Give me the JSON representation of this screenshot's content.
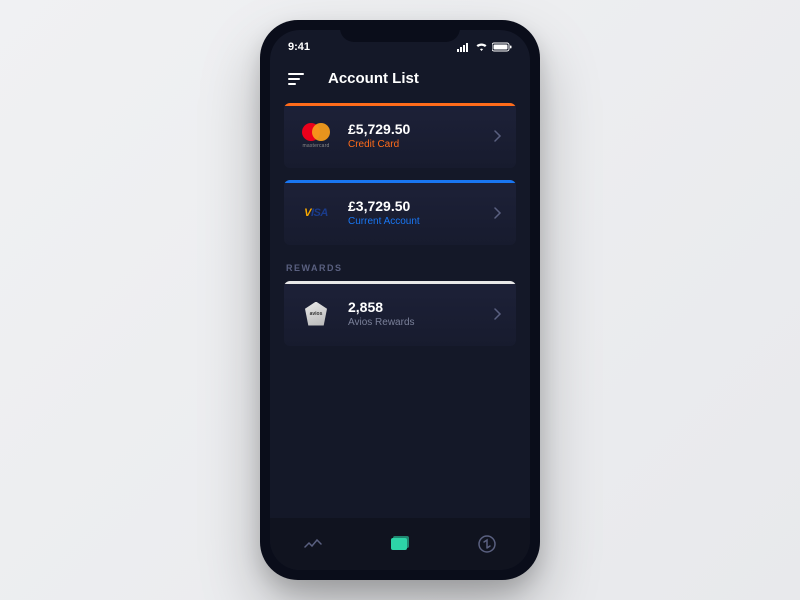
{
  "status": {
    "time": "9:41"
  },
  "header": {
    "title": "Account List"
  },
  "accounts": [
    {
      "brand": "mastercard",
      "amount": "£5,729.50",
      "label": "Credit Card",
      "accent": "orange"
    },
    {
      "brand": "VISA",
      "amount": "£3,729.50",
      "label": "Current Account",
      "accent": "blue"
    }
  ],
  "rewards_heading": "REWARDS",
  "rewards": [
    {
      "brand": "avios",
      "amount": "2,858",
      "label": "Avios Rewards",
      "accent": "white"
    }
  ]
}
